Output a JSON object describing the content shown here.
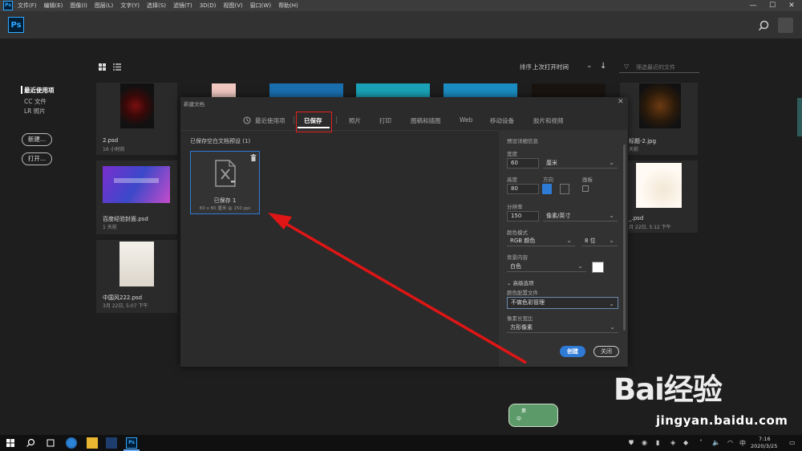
{
  "menubar": {
    "logo": "Ps",
    "items": [
      "文件(F)",
      "编辑(E)",
      "图像(I)",
      "图层(L)",
      "文字(Y)",
      "选择(S)",
      "滤镜(T)",
      "3D(D)",
      "视图(V)",
      "窗口(W)",
      "帮助(H)"
    ],
    "window_controls": [
      "—",
      "☐",
      "✕"
    ]
  },
  "appbar": {
    "logo": "Ps"
  },
  "nav": {
    "items": [
      "最近使用项",
      "CC 文件",
      "LR 照片"
    ],
    "new_button": "新建...",
    "open_button": "打开..."
  },
  "toolbar": {
    "sort_label": "排序",
    "sort_value": "上次打开时间",
    "filter_placeholder": "筛选最近的文件"
  },
  "files": [
    {
      "name": "2.psd",
      "meta": "16 小时前"
    },
    {
      "name": "百度经验封面.psd",
      "meta": "1 天前"
    },
    {
      "name": "中国风222.psd",
      "meta": "3月 22日, 5:07 下午"
    },
    {
      "name": "标题-2.jpg",
      "meta": "天前"
    },
    {
      "name": "_.psd",
      "meta": "月 22日, 5:12 下午"
    }
  ],
  "dialog": {
    "title": "新建文档",
    "tabs": [
      "最近使用项",
      "已保存",
      "照片",
      "打印",
      "图稿和插图",
      "Web",
      "移动设备",
      "胶片和视频"
    ],
    "active_tab": "已保存",
    "section_title": "已保存空白文档预设",
    "section_count": "(1)",
    "preset": {
      "name": "已保存 1",
      "info": "60 x 80 厘米 @ 150 ppi"
    },
    "panel": {
      "header": "预设详细信息",
      "width_label": "宽度",
      "width_value": "60",
      "width_unit": "厘米",
      "height_label": "高度",
      "height_value": "80",
      "orientation_label": "方向",
      "artboard_label": "画板",
      "resolution_label": "分辨率",
      "resolution_value": "150",
      "resolution_unit": "像素/英寸",
      "color_mode_label": "颜色模式",
      "color_mode_value": "RGB 颜色",
      "bit_depth": "8 位",
      "background_label": "背景内容",
      "background_value": "白色",
      "background_color": "#ffffff",
      "advanced_label": "高级选项",
      "profile_label": "颜色配置文件",
      "profile_value": "不做色彩管理",
      "pixel_aspect_label": "像素长宽比",
      "pixel_aspect_value": "方形像素",
      "create_button": "创建",
      "close_button": "关闭"
    }
  },
  "watermark": {
    "logo": "Bai经验",
    "url": "jingyan.baidu.com"
  },
  "badge": {
    "line1": "第",
    "line2": "中"
  },
  "taskbar": {
    "time": "7:16",
    "date": "2020/3/25",
    "tray_lang": "中"
  },
  "colors": {
    "accent": "#2e7bd6",
    "highlight": "#e02020",
    "ps_blue": "#31a8ff"
  }
}
